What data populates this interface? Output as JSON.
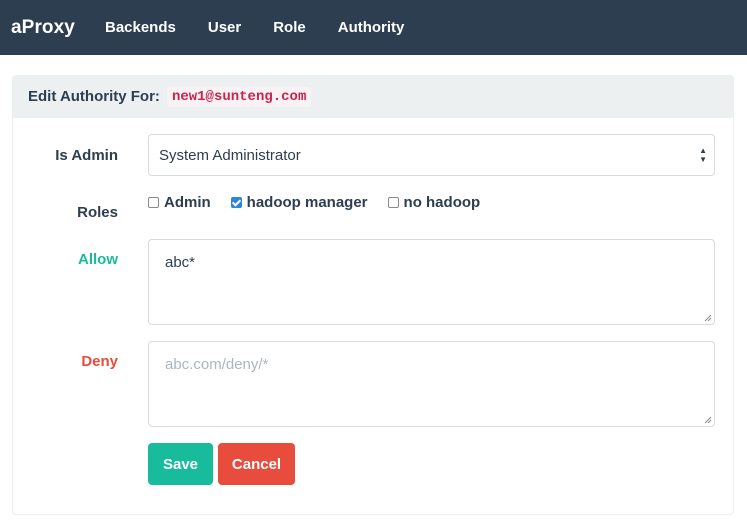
{
  "navbar": {
    "brand": "aProxy",
    "items": [
      {
        "label": "Backends"
      },
      {
        "label": "User"
      },
      {
        "label": "Role"
      },
      {
        "label": "Authority"
      }
    ]
  },
  "panel": {
    "title": "Edit Authority For:",
    "user": "new1@sunteng.com"
  },
  "form": {
    "is_admin": {
      "label": "Is Admin",
      "selected": "System Administrator"
    },
    "roles": {
      "label": "Roles",
      "options": [
        {
          "label": "Admin",
          "checked": false
        },
        {
          "label": "hadoop manager",
          "checked": true
        },
        {
          "label": "no hadoop",
          "checked": false
        }
      ]
    },
    "allow": {
      "label": "Allow",
      "value": "abc*"
    },
    "deny": {
      "label": "Deny",
      "value": "",
      "placeholder": "abc.com/deny/*"
    },
    "save_label": "Save",
    "cancel_label": "Cancel"
  },
  "colors": {
    "navbar": "#2c3e50",
    "success": "#18bc9c",
    "danger": "#e74c3c",
    "checkbox_checked": "#2e86de"
  }
}
